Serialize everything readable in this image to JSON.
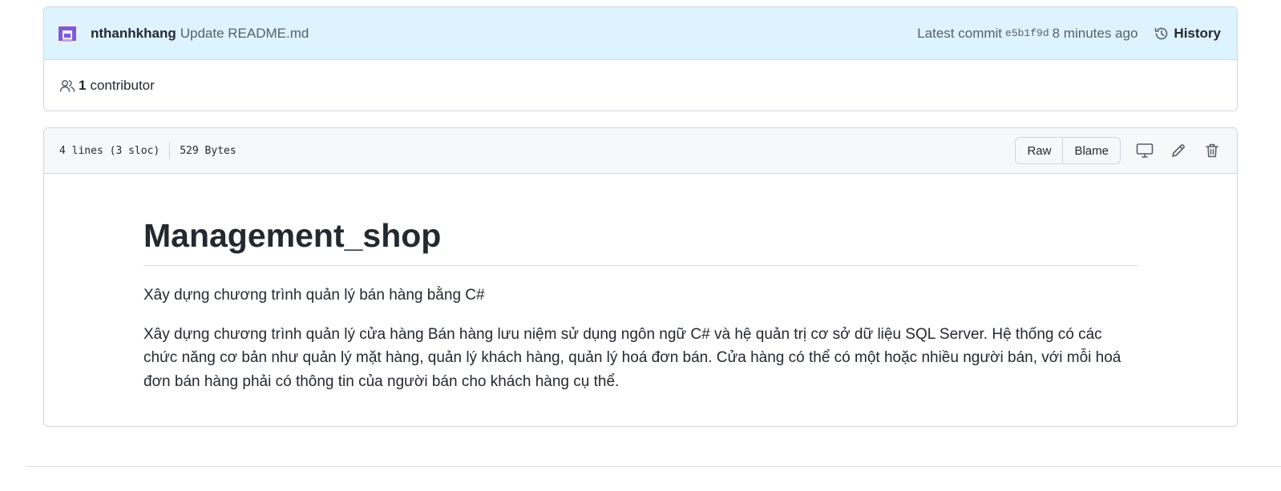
{
  "commit": {
    "author": "nthanhkhang",
    "message": "Update README.md",
    "latest_label": "Latest commit",
    "sha": "e5b1f9d",
    "time": "8 minutes ago",
    "history_label": "History"
  },
  "contributors": {
    "count": "1",
    "label": "contributor"
  },
  "file": {
    "lines": "4 lines (3 sloc)",
    "size": "529 Bytes",
    "raw_label": "Raw",
    "blame_label": "Blame"
  },
  "readme": {
    "title": "Management_shop",
    "paragraph1": "Xây dựng chương trình quản lý bán hàng bằng C#",
    "paragraph2": "Xây dựng chương trình quản lý cửa hàng Bán hàng lưu niệm sử dụng ngôn ngữ C# và hệ quản trị cơ sở dữ liệu SQL Server. Hệ thống có các chức năng cơ bản như quản lý mặt hàng, quản lý khách hàng, quản lý hoá đơn bán. Cửa hàng có thể có một hoặc nhiều người bán, với mỗi hoá đơn bán hàng phải có thông tin của người bán cho khách hàng cụ thể."
  },
  "icons": {
    "avatar": "avatar-identicon",
    "history": "history-icon",
    "contributors": "people-icon",
    "desktop": "desktop-icon",
    "edit": "pencil-icon",
    "delete": "trash-icon"
  },
  "colors": {
    "commit_bar_bg": "#ddf4ff",
    "avatar": "#7c5cd6",
    "text": "#24292f",
    "muted": "#57606a"
  }
}
